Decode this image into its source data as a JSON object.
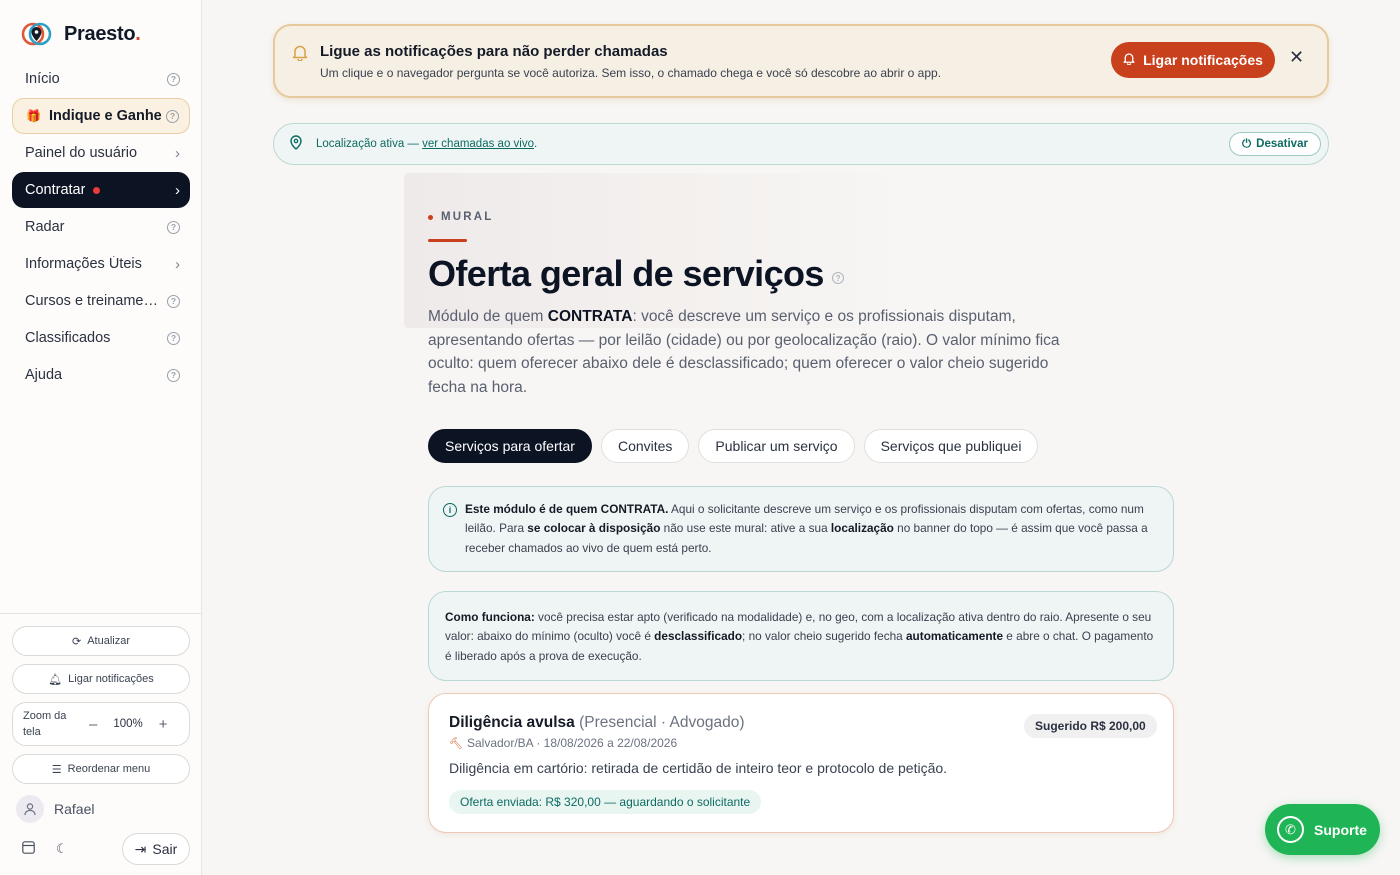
{
  "brand": {
    "name": "Praesto",
    "dot": "."
  },
  "sidebar": {
    "items": [
      {
        "label": "Início",
        "trail": "help"
      },
      {
        "label": "Indique e Ganhe",
        "trail": "help"
      },
      {
        "label": "Painel do usuário",
        "trail": "chevron"
      },
      {
        "label": "Contratar",
        "trail": "chevron"
      },
      {
        "label": "Radar",
        "trail": "help"
      },
      {
        "label": "Informações Úteis",
        "trail": "chevron"
      },
      {
        "label": "Cursos e treinamentos",
        "trail": "help"
      },
      {
        "label": "Classificados",
        "trail": "help"
      },
      {
        "label": "Ajuda",
        "trail": "help"
      }
    ],
    "refresh_label": "Atualizar",
    "notif_label": "Ligar notificações",
    "zoom_label": "Zoom da tela",
    "zoom_minus": "–",
    "zoom_value": "100%",
    "zoom_plus": "+",
    "reorder_label": "Reordenar menu",
    "user_name": "Rafael",
    "logout_label": "Sair"
  },
  "notif_banner": {
    "title": "Ligue as notificações para não perder chamadas",
    "desc": "Um clique e o navegador pergunta se você autoriza. Sem isso, o chamado chega e você só descobre ao abrir o app.",
    "cta_label": "Ligar notificações",
    "close": "✕"
  },
  "location_bar": {
    "prefix": "Localização ativa — ",
    "link": "ver chamadas ao vivo",
    "suffix": ".",
    "deactivate_label": "Desativar"
  },
  "hero": {
    "kicker": "MURAL",
    "title": "Oferta geral de serviços",
    "desc_prefix": "Módulo de quem ",
    "desc_bold": "CONTRATA",
    "desc_rest": ": você descreve um serviço e os profissionais disputam, apresentando ofertas — por leilão (cidade) ou por geolocalização (raio). O valor mínimo fica oculto: quem oferecer abaixo dele é desclassificado; quem oferecer o valor cheio sugerido fecha na hora."
  },
  "tabs": [
    {
      "label": "Serviços para ofertar",
      "active": true
    },
    {
      "label": "Convites",
      "active": false
    },
    {
      "label": "Publicar um serviço",
      "active": false
    },
    {
      "label": "Serviços que publiquei",
      "active": false
    }
  ],
  "info1": {
    "b1": "Este módulo é de quem CONTRATA.",
    "t1": " Aqui o solicitante descreve um serviço e os profissionais disputam com ofertas, como num leilão. Para ",
    "b2": "se colocar à disposição",
    "t2": " não use este mural: ative a sua ",
    "b3": "localização",
    "t3": " no banner do topo — é assim que você passa a receber chamados ao vivo de quem está perto."
  },
  "info2": {
    "b1": "Como funciona:",
    "t1": " você precisa estar apto (verificado na modalidade) e, no geo, com a localização ativa dentro do raio. Apresente o seu valor: abaixo do mínimo (oculto) você é ",
    "b2": "desclassificado",
    "t2": "; no valor cheio sugerido fecha ",
    "b3": "automaticamente",
    "t3": " e abre o chat. O pagamento é liberado após a prova de execução."
  },
  "card": {
    "title": "Diligência avulsa",
    "subtitle": " (Presencial · Advogado)",
    "meta": "Salvador/BA · 18/08/2026 a 22/08/2026",
    "price": "Sugerido R$ 200,00",
    "body": "Diligência em cartório: retirada de certidão de inteiro teor e protocolo de petição.",
    "status": "Oferta enviada: R$ 320,00 — aguardando o solicitante"
  },
  "support": {
    "label": "Suporte"
  },
  "colors": {
    "accent": "#c8401c",
    "dark": "#0c1424",
    "teal": "#0e6b63",
    "whatsapp": "#1fb556"
  }
}
